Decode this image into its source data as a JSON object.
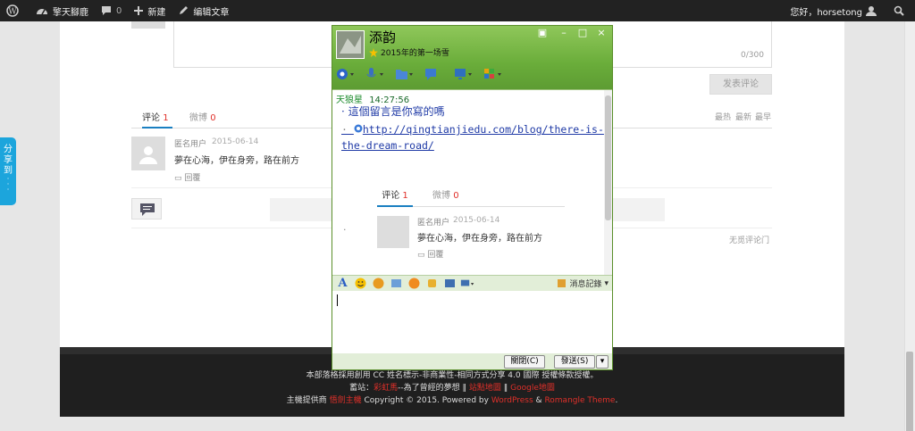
{
  "admin_bar": {
    "site_name": "擎天腳鹿",
    "comments_count": "0",
    "new_label": "新建",
    "edit_label": "编辑文章",
    "greeting": "您好，horsetong"
  },
  "share_sidebar": {
    "label": "分享到"
  },
  "comment_form": {
    "counter": "0/300",
    "submit_label": "发表评论"
  },
  "tabs": {
    "comments_label": "评论",
    "comments_count": "1",
    "weibo_label": "微博",
    "weibo_count": "0",
    "sort_hot": "最热",
    "sort_new": "最新",
    "sort_old": "最早"
  },
  "comment": {
    "user": "匿名用户",
    "date": "2015-06-14",
    "text": "夢在心海，伊在身旁，路在前方",
    "reply_label": "回覆"
  },
  "no_comment_link": "无觅评论门",
  "footer": {
    "line1": "本部落格採用創用 CC 姓名標示-非商業性-相同方式分享 4.0 國際 授權條款授權。",
    "line2_prefix": "蓄站：",
    "line2_link1": "彩虹馬",
    "line2_mid": "--為了曾經的夢想 ‖",
    "line2_link2": "站點地圖",
    "line2_sep": "‖",
    "line2_link3": "Google地圖",
    "line3_prefix": "主機提供商",
    "line3_host": "悟劍主機",
    "line3_mid": "Copyright © 2015. Powered by",
    "line3_wp": "WordPress",
    "line3_and": "&",
    "line3_theme": "Romangle Theme",
    "line3_end": "."
  },
  "qq_window": {
    "contact_name": "添韵",
    "signature": "2015年的第一场雪",
    "sender": "天狼星",
    "time": "14:27:56",
    "message1": "這個留言是你寫的嗎",
    "message2": "http://qingtianjiedu.com/blog/there-is-the-dream-road/",
    "history_label": "消息記錄",
    "close_label": "關閉(C)",
    "send_label": "發送(S)"
  },
  "embedded_preview": {
    "comments_label": "评论",
    "comments_count": "1",
    "weibo_label": "微博",
    "weibo_count": "0",
    "user": "匿名用户",
    "date": "2015-06-14",
    "text": "夢在心海，伊在身旁，路在前方",
    "reply_label": "回覆"
  },
  "colors": {
    "accent_red": "#e0302a",
    "qq_green": "#6aad3a",
    "share_blue": "#1ca5dc"
  }
}
